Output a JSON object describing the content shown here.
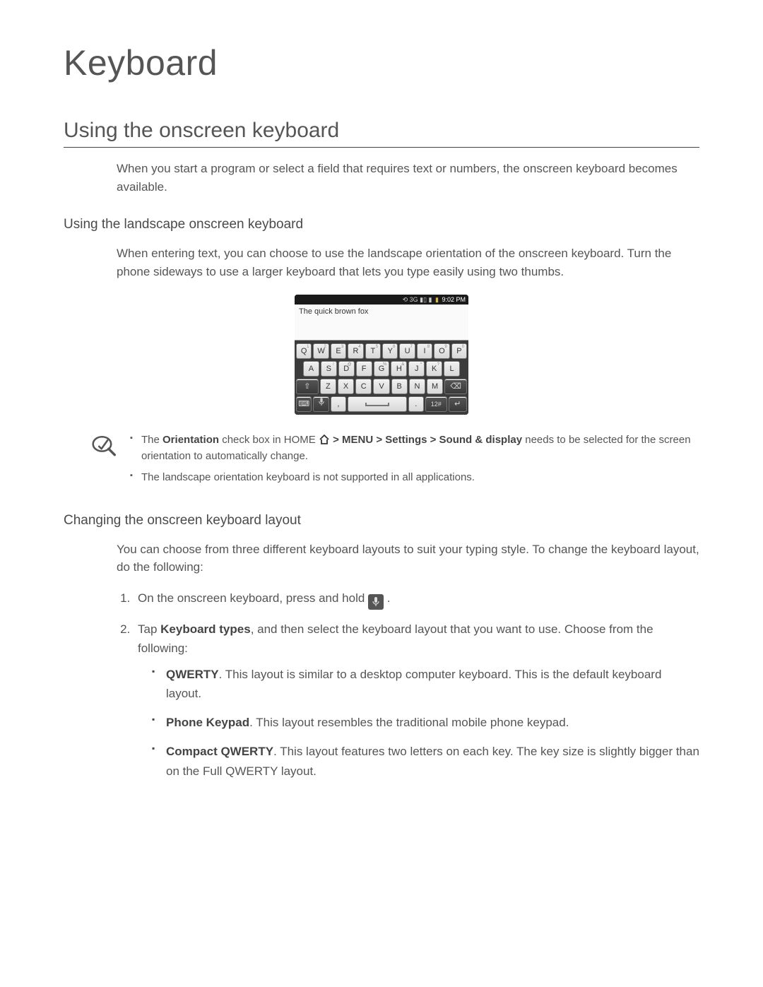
{
  "title": "Keyboard",
  "section_title": "Using the onscreen keyboard",
  "intro": "When you start a program or select a field that requires text or numbers, the onscreen keyboard becomes available.",
  "landscape": {
    "heading": "Using the landscape onscreen keyboard",
    "body": "When entering text, you can choose to use the landscape orientation of the onscreen keyboard. Turn the phone sideways to use a larger keyboard that lets you type easily using two thumbs."
  },
  "screenshot": {
    "status": {
      "icons": "⟲ 3G ▮▯ ▮",
      "time": "9:02 PM"
    },
    "textbox": "The quick brown fox",
    "rows": [
      [
        {
          "l": "Q",
          "s": "1"
        },
        {
          "l": "W",
          "s": "2"
        },
        {
          "l": "E",
          "s": "3"
        },
        {
          "l": "R",
          "s": "4"
        },
        {
          "l": "T",
          "s": "5"
        },
        {
          "l": "Y",
          "s": "6"
        },
        {
          "l": "U",
          "s": "7"
        },
        {
          "l": "I",
          "s": "8"
        },
        {
          "l": "O",
          "s": "9"
        },
        {
          "l": "P",
          "s": "0"
        }
      ],
      [
        {
          "l": "A",
          "s": ""
        },
        {
          "l": "S",
          "s": "!"
        },
        {
          "l": "D",
          "s": "@"
        },
        {
          "l": "F",
          "s": ""
        },
        {
          "l": "G",
          "s": "%"
        },
        {
          "l": "H",
          "s": "&"
        },
        {
          "l": "J",
          "s": "*"
        },
        {
          "l": "K",
          "s": "?"
        },
        {
          "l": "L",
          "s": ""
        }
      ],
      {
        "shift": "⇧",
        "keys": [
          {
            "l": "Z"
          },
          {
            "l": "X"
          },
          {
            "l": "C"
          },
          {
            "l": "V"
          },
          {
            "l": "B"
          },
          {
            "l": "N"
          },
          {
            "l": "M"
          }
        ],
        "bksp": "⌫"
      },
      {
        "ime": "⌨",
        "mic": "🎤",
        "comma": ",",
        "space": "",
        "period": ".",
        "num": "12#",
        "enter": "↵"
      }
    ]
  },
  "notes": {
    "n1_pre": "The ",
    "n1_b1": "Orientation",
    "n1_mid": " check box in HOME ",
    "n1_b2": " > MENU > Settings > Sound & display",
    "n1_post": " needs to be selected for the screen orientation to automatically change.",
    "n2": "The landscape orientation keyboard is not supported in all applications."
  },
  "layout": {
    "heading": "Changing the onscreen keyboard layout",
    "intro": "You can choose from three different keyboard layouts to suit your typing style. To change the keyboard layout, do the following:",
    "step1_pre": "On the onscreen keyboard, press and hold ",
    "step1_post": " .",
    "step2_pre": "Tap ",
    "step2_b": "Keyboard types",
    "step2_post": ", and then select the keyboard layout that you want to use. Choose from the following:",
    "opts": [
      {
        "b": "QWERTY",
        "t": ". This layout is similar to a desktop computer keyboard. This is the default keyboard layout."
      },
      {
        "b": "Phone Keypad",
        "t": ". This layout resembles the traditional mobile phone keypad."
      },
      {
        "b": "Compact QWERTY",
        "t": ". This layout features two letters on each key. The key size is slightly bigger than on the Full QWERTY layout."
      }
    ]
  }
}
